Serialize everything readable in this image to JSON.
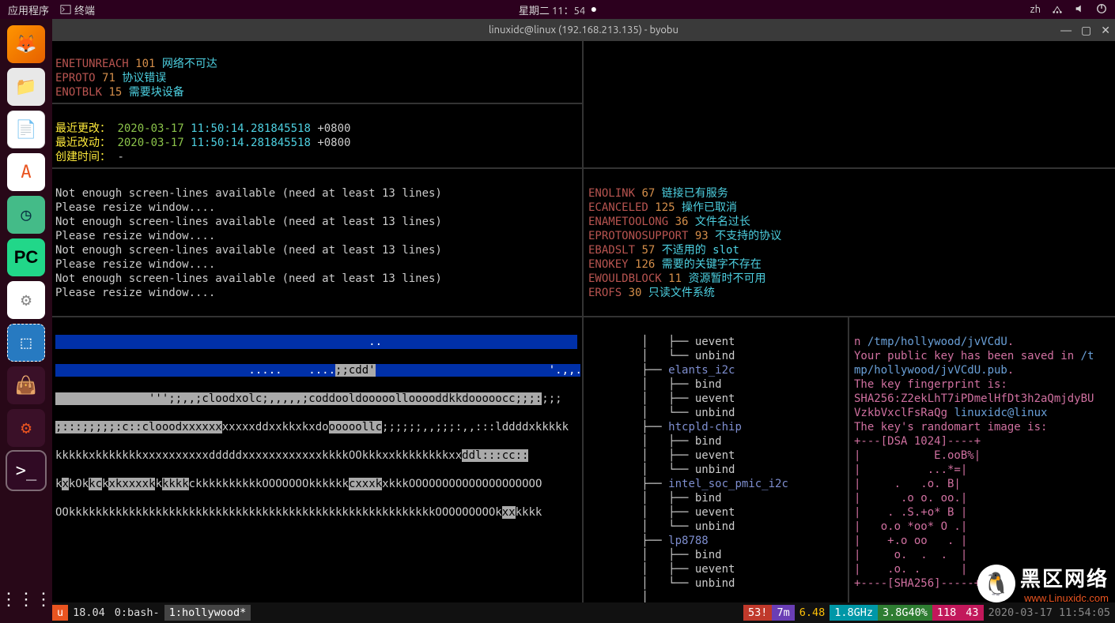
{
  "topbar": {
    "apps": "应用程序",
    "terminal": "终端",
    "clock": "星期二 11：54",
    "ime": "zh"
  },
  "window": {
    "title": "linuxidc@linux (192.168.213.135) - byobu"
  },
  "pane_top_left": {
    "l1_code": "ENETUNREACH",
    "l1_num": "101",
    "l1_msg": "网络不可达",
    "l2_code": "EPROTO",
    "l2_num": "71",
    "l2_msg": "协议错误",
    "l3_code": "ENOTBLK",
    "l3_num": "15",
    "l3_msg": "需要块设备"
  },
  "pane_meta": {
    "label1": "最近更改：",
    "date1": "2020-03-17",
    "time1": "11:50:14.281845518",
    "tz1": "+0800",
    "label2": "最近改动：",
    "date2": "2020-03-17",
    "time2": "11:50:14.281845518",
    "tz2": "+0800",
    "label3": "创建时间：",
    "val3": "-"
  },
  "resize_msg1": "Not enough screen-lines available (need at least 13 lines)",
  "resize_msg2": "Please resize window....",
  "errno": {
    "e1_code": "ENOLINK",
    "e1_num": "67",
    "e1_msg": "链接已有服务",
    "e2_code": "ECANCELED",
    "e2_num": "125",
    "e2_msg": "操作已取消",
    "e3_code": "ENAMETOOLONG",
    "e3_num": "36",
    "e3_msg": "文件名过长",
    "e4_code": "EPROTONOSUPPORT",
    "e4_num": "93",
    "e4_msg": "不支持的协议",
    "e5_code": "EBADSLT",
    "e5_num": "57",
    "e5_msg": "不适用的 slot",
    "e6_code": "ENOKEY",
    "e6_num": "126",
    "e6_msg": "需要的关键字不存在",
    "e7_code": "EWOULDBLOCK",
    "e7_num": "11",
    "e7_msg": "资源暂时不可用",
    "e8_code": "EROFS",
    "e8_num": "30",
    "e8_msg": "只读文件系统"
  },
  "tree": {
    "t1": "├── uevent",
    "t2": "└── unbind",
    "d1": "elants_i2c",
    "t3": "├── bind",
    "t4": "├── uevent",
    "t5": "└── unbind",
    "d2": "htcpld-chip",
    "t6": "├── bind",
    "t7": "├── uevent",
    "t8": "└── unbind",
    "d3": "intel_soc_pmic_i2c",
    "t9": "├── bind",
    "t10": "├── uevent",
    "t11": "└── unbind",
    "d4": "lp8788",
    "t12": "├── bind",
    "t13": "├── uevent",
    "t14": "└── unbind",
    "t15": "│"
  },
  "ssh": {
    "l1a": "n ",
    "l1b": "/tmp/hollywood/jvVCdU",
    "l1c": ".",
    "l2a": "Your public key has been saved in ",
    "l2b": "/t",
    "l3a": "mp/hollywood/jvVCdU.pub",
    "l3b": ".",
    "l4": "The key fingerprint is:",
    "l5": "SHA256:Z2ekLhT7iPDmelHfDt3h2aQmjdyBU",
    "l6a": "VzkbVxclFsRaQg ",
    "l6b": "linuxidc@linux",
    "l7": "The key's randomart image is:",
    "l8": "+---[DSA 1024]----+",
    "r1": "|           E.ooB%|",
    "r2": "|          ...*=|",
    "r3": "|     .   .o. B|",
    "r4": "|      .o o. oo.|",
    "r5": "|    . .S.+o* B |",
    "r6": "|   o.o *oo* O .|",
    "r7": "|    +.o oo   . |",
    "r8": "|     o.  .  .  |",
    "r9": "|    .o. .      |",
    "l9": "+----[SHA256]-----+"
  },
  "ascii": {
    "a1": "                                               ..",
    "a2a": "                             .....    ....",
    "a2b": ";;cdd'",
    "a2c": "                          '.,,.",
    "a3a": "              ''';;,,;cloodxolc;,,,,,;coddooldooooollooooddkkdooooocc;;;:",
    "a3b": ";;;",
    "a4a": ";:::;;;;;:c::clooodxxxxxx",
    "a4b": "xxxxxddxxkkxkxdo",
    "a4c": "ooooollc",
    "a4d": ";;;;;;,,;;;:,,:::ld",
    "a4e": "dddxkkkkk",
    "a5a": "kkkkkxkkkkkkkxxxxxxxxxxdddddxxxxxxxxxxxxkkkkOOkkkxxkkkkkkkkxx",
    "a5b": "ddl:::cc::",
    "a6a": "k",
    "a6b": "x",
    "a6c": "kOk",
    "a6d": "kc",
    "a6e": "k",
    "a6f": "xkxxxxk",
    "a6g": "k",
    "a6h": "kkkk",
    "a6i": "c",
    "a6j": "kkkkkkkkkkOOOOOOOkkkkkk",
    "a6k": "cxxxk",
    "a6l": "xkkkOOOOOOOOOOOOOOOOOOOO",
    "a7a": "OOkkkkkkkkkkkkkkkkkkkkkkkkkkkkkkkkkkkkkkkkkkkkkkkkkkkkkkkOOOOOOOOOk",
    "a7b": "xx",
    "a7c": "kkkk"
  },
  "status": {
    "distro": "u ",
    "ver": "18.04",
    "tab0": "0:bash-",
    "tab1": "1:hollywood*",
    "s53": "53!",
    "s7m": "7m",
    "load": "6.48",
    "ghz": "1.8GHz",
    "mem": "3.8G40%",
    "d1": "118",
    "d2": "43",
    "time": "2020-03-17 11:54:05"
  },
  "watermark": {
    "l1": "黑区网络",
    "l2": "www.Linuxidc.com"
  }
}
